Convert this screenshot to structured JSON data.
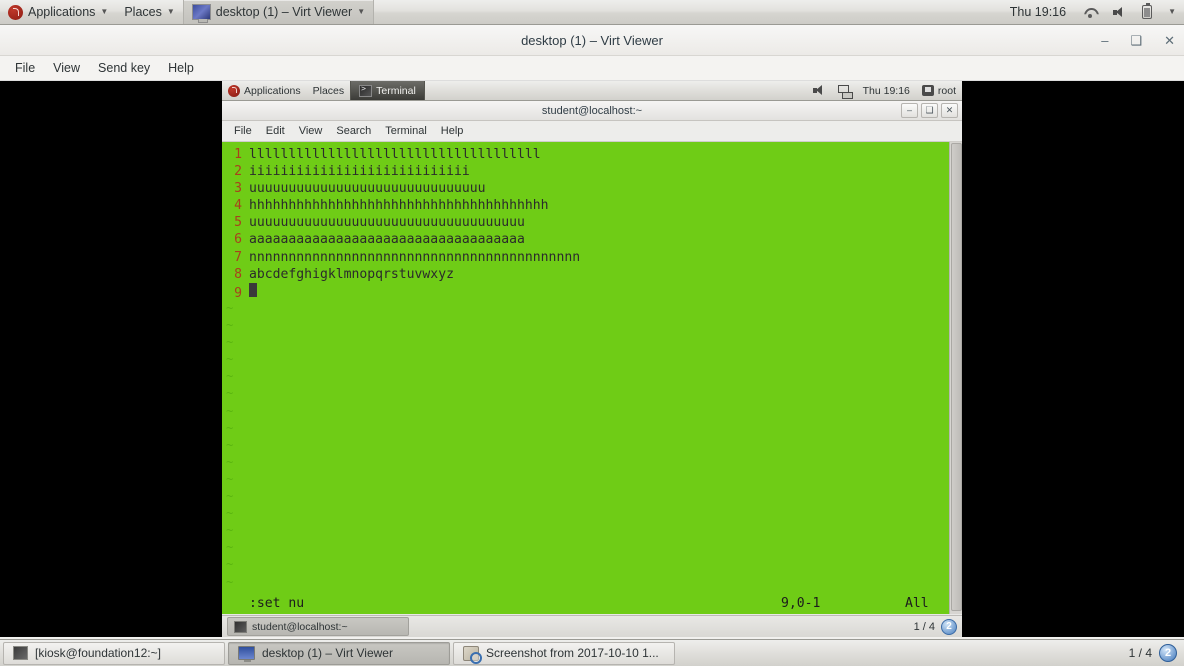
{
  "host_panel": {
    "applications_label": "Applications",
    "places_label": "Places",
    "active_window_label": "desktop (1) – Virt Viewer",
    "clock": "Thu 19:16",
    "icons": [
      "fedora-logo",
      "wifi-icon",
      "volume-icon",
      "battery-icon",
      "chevron-down-icon"
    ]
  },
  "virt_viewer": {
    "title": "desktop (1) – Virt Viewer",
    "window_buttons": {
      "minimize": "‒",
      "maximize": "❑",
      "close": "✕"
    },
    "menu": [
      "File",
      "View",
      "Send key",
      "Help"
    ]
  },
  "guest_panel": {
    "applications_label": "Applications",
    "places_label": "Places",
    "task_label": "Terminal",
    "clock": "Thu 19:16",
    "user_label": "root"
  },
  "guest_terminal": {
    "title": "student@localhost:~",
    "menu": [
      "File",
      "Edit",
      "View",
      "Search",
      "Terminal",
      "Help"
    ],
    "window_buttons": {
      "minimize": "‒",
      "maximize": "❑",
      "close": "✕"
    },
    "tab_label": "student@localhost:~",
    "pages_indicator": "1 / 4",
    "workspace_badge": "2"
  },
  "vim": {
    "lines": [
      {
        "num": "1",
        "text": "lllllllllllllllllllllllllllllllllllll"
      },
      {
        "num": "2",
        "text": "iiiiiiiiiiiiiiiiiiiiiiiiiiii"
      },
      {
        "num": "3",
        "text": "uuuuuuuuuuuuuuuuuuuuuuuuuuuuuu"
      },
      {
        "num": "4",
        "text": "hhhhhhhhhhhhhhhhhhhhhhhhhhhhhhhhhhhhhh"
      },
      {
        "num": "5",
        "text": "uuuuuuuuuuuuuuuuuuuuuuuuuuuuuuuuuuu"
      },
      {
        "num": "6",
        "text": "aaaaaaaaaaaaaaaaaaaaaaaaaaaaaaaaaaa"
      },
      {
        "num": "7",
        "text": "nnnnnnnnnnnnnnnnnnnnnnnnnnnnnnnnnnnnnnnnnn"
      },
      {
        "num": "8",
        "text": "abcdefghigklmnopqrstuvwxyz"
      },
      {
        "num": "9",
        "text": ""
      }
    ],
    "status_command": ":set nu",
    "status_position": "9,0-1",
    "status_scroll": "All",
    "colors": {
      "background": "#6fcc16",
      "foreground": "#2b2b2b",
      "line_number": "#a8411c",
      "tilde": "#5ab510"
    }
  },
  "host_taskbar": {
    "tasks": [
      {
        "label": "[kiosk@foundation12:~]",
        "icon": "terminal-icon",
        "active": false
      },
      {
        "label": "desktop (1) – Virt Viewer",
        "icon": "monitor-icon",
        "active": true
      },
      {
        "label": "Screenshot from 2017-10-10 1...",
        "icon": "screenshot-icon",
        "active": false
      }
    ],
    "pages_indicator": "1 / 4",
    "workspace_badge": "2"
  }
}
